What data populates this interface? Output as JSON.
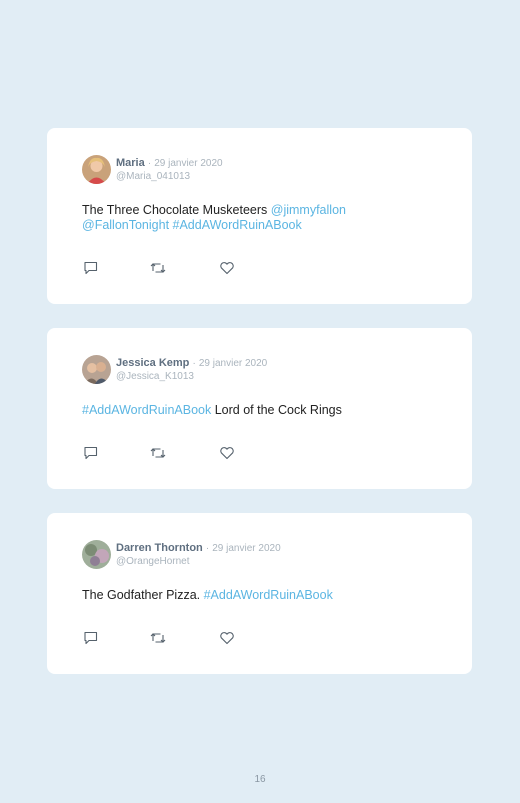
{
  "tweets": [
    {
      "name": "Maria",
      "date": "29 janvier 2020",
      "handle": "@Maria_041013",
      "text_parts": [
        "The Three Chocolate Musketeers ",
        "@jimmyfallon",
        "@FallonTonight #AddAWordRuinABook"
      ]
    },
    {
      "name": "Jessica Kemp",
      "date": "29 janvier 2020",
      "handle": "@Jessica_K1013",
      "text_parts": [
        "#AddAWordRuinABook",
        " Lord of the Cock Rings"
      ]
    },
    {
      "name": "Darren Thornton",
      "date": "29 janvier 2020",
      "handle": "@OrangeHornet",
      "text_parts": [
        "The Godfather Pizza. ",
        "#AddAWordRuinABook"
      ]
    }
  ],
  "separator": "·",
  "icons": [
    "reply-icon",
    "retweet-icon",
    "like-icon"
  ],
  "colors": {
    "page_background": "#e1edf5",
    "card_background": "#ffffff",
    "link": "#5bb5e2"
  },
  "page_number": "16"
}
